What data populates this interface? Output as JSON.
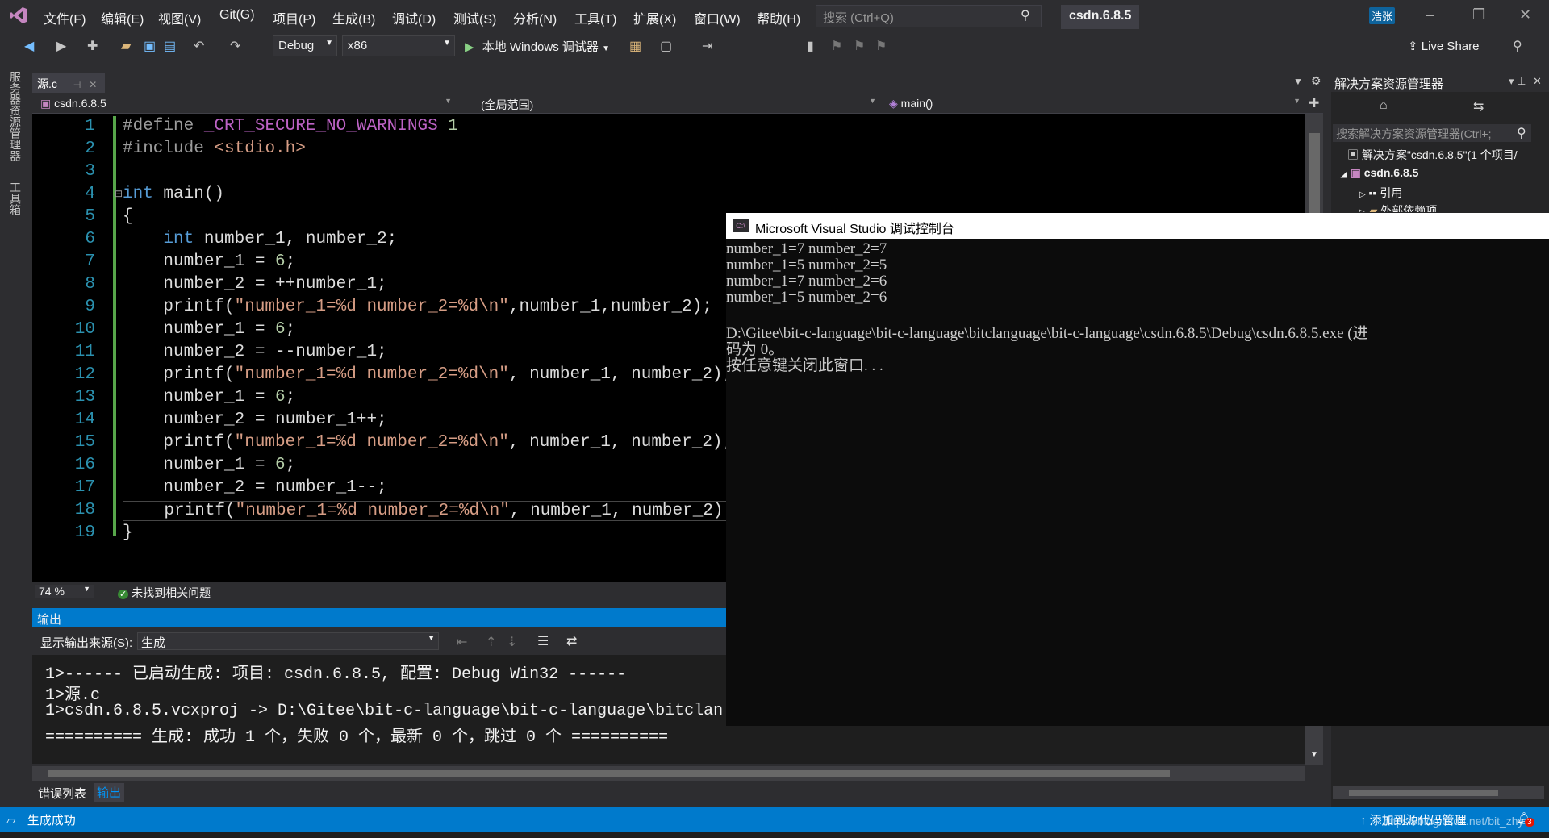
{
  "menu": [
    "文件(F)",
    "编辑(E)",
    "视图(V)",
    "Git(G)",
    "项目(P)",
    "生成(B)",
    "调试(D)",
    "测试(S)",
    "分析(N)",
    "工具(T)",
    "扩展(X)",
    "窗口(W)",
    "帮助(H)"
  ],
  "search": {
    "placeholder": "搜索 (Ctrl+Q)"
  },
  "project_name": "csdn.6.8.5",
  "user_badge": "浩张",
  "toolbar": {
    "config": "Debug",
    "platform": "x86",
    "run_label": "本地 Windows 调试器",
    "live_share": "Live Share"
  },
  "side_strip": {
    "server_explorer": "服务器资源管理器",
    "toolbox": "工具箱"
  },
  "document_tab": {
    "name": "源.c"
  },
  "navbar": {
    "project": "csdn.6.8.5",
    "scope": "(全局范围)",
    "function": "main()"
  },
  "editor": {
    "line_numbers": [
      "1",
      "2",
      "3",
      "4",
      "5",
      "6",
      "7",
      "8",
      "9",
      "10",
      "11",
      "12",
      "13",
      "14",
      "15",
      "16",
      "17",
      "18",
      "19"
    ],
    "zoom": "74 %",
    "issues": "未找到相关问题"
  },
  "output": {
    "title": "输出",
    "source_label": "显示输出来源(S):",
    "source_value": "生成",
    "lines": [
      "1>------ 已启动生成: 项目: csdn.6.8.5, 配置: Debug Win32 ------",
      "1>源.c",
      "1>csdn.6.8.5.vcxproj -> D:\\Gitee\\bit-c-language\\bit-c-language\\bitclan",
      "========== 生成: 成功 1 个，失败 0 个，最新 0 个，跳过 0 个 =========="
    ]
  },
  "bottom_tabs": {
    "errors": "错误列表",
    "output": "输出"
  },
  "console": {
    "title": "Microsoft Visual Studio 调试控制台",
    "lines": [
      "number_1=7 number_2=7",
      "number_1=5 number_2=5",
      "number_1=7 number_2=6",
      "number_1=5 number_2=6",
      "",
      "D:\\Gitee\\bit-c-language\\bit-c-language\\bitclanguage\\bit-c-language\\csdn.6.8.5\\Debug\\csdn.6.8.5.exe (进",
      "码为 0。",
      "按任意键关闭此窗口. . ."
    ]
  },
  "solution_explorer": {
    "title": "解决方案资源管理器",
    "search_placeholder": "搜索解决方案资源管理器(Ctrl+;",
    "solution": "解决方案\"csdn.6.8.5\"(1 个项目/",
    "project": "csdn.6.8.5",
    "references": "引用",
    "external": "外部依赖项"
  },
  "statusbar": {
    "left": "生成成功",
    "right": "添加到源代码管理",
    "watermark": "https://blog.csdn.net/bit_zhy",
    "notif_count": "3"
  }
}
